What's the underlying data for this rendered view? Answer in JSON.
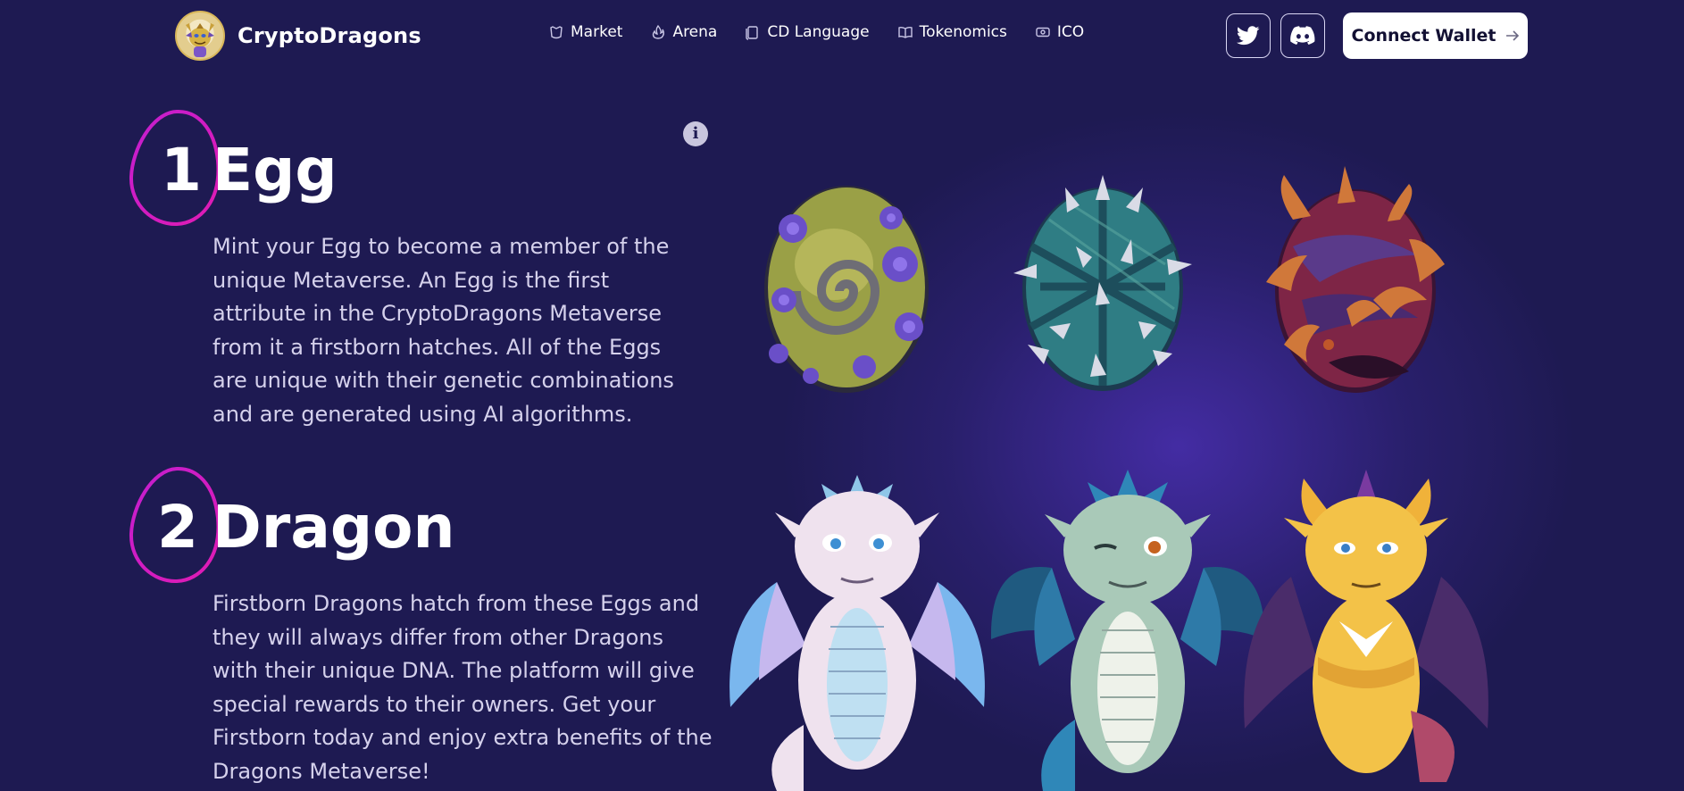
{
  "brand": {
    "name": "CryptoDragons",
    "logo_icon": "dragon-logo-icon"
  },
  "nav": {
    "items": [
      {
        "label": "Market",
        "icon": "market-icon"
      },
      {
        "label": "Arena",
        "icon": "flame-icon"
      },
      {
        "label": "CD Language",
        "icon": "document-icon"
      },
      {
        "label": "Tokenomics",
        "icon": "book-icon"
      },
      {
        "label": "ICO",
        "icon": "coin-ticket-icon"
      }
    ],
    "twitter_icon": "twitter-icon",
    "discord_icon": "discord-icon",
    "wallet_label": "Connect Wallet",
    "wallet_icon": "arrow-right-icon"
  },
  "steps": [
    {
      "number": "1",
      "title": "Egg",
      "text": "Mint your Egg to become a member of the unique Metaverse. An Egg is the first attribute in the CryptoDragons Metaverse from it a firstborn hatches. All of the Eggs are unique with their genetic combinations and are generated using AI algorithms.",
      "info_icon": "info-icon"
    },
    {
      "number": "2",
      "title": "Dragon",
      "text": "Firstborn Dragons hatch from these Eggs and they will always differ from other Dragons with their unique DNA. The platform will give special rewards to their owners. Get your Firstborn today and enjoy extra benefits of the Dragons Metaverse!"
    }
  ],
  "colors": {
    "background": "#1e1a52",
    "accent_ring": "#c81fd0",
    "text_muted": "#d5d1ec"
  }
}
